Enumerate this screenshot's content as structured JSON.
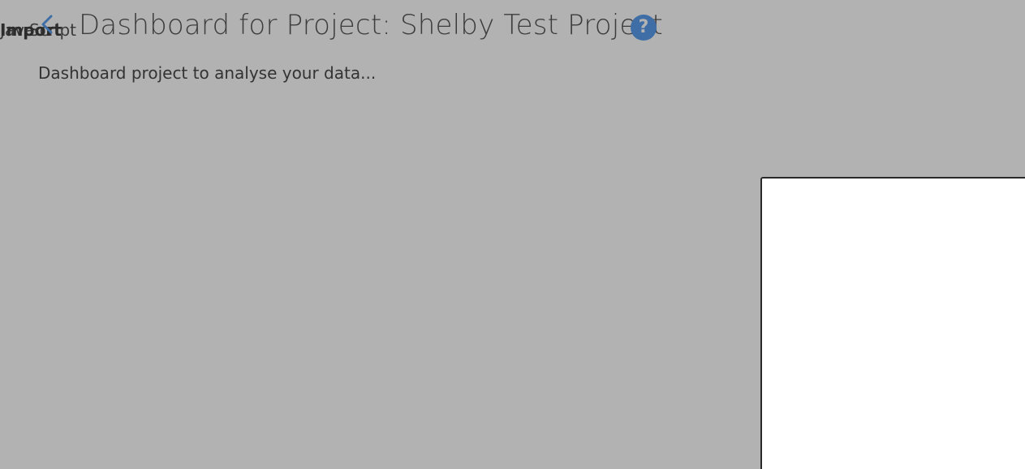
{
  "background_color": "#b2b2b2",
  "accent_color": "#3f6ea6",
  "header": {
    "overlapping_labels": [
      "Java",
      "Script",
      "Vega",
      "Leaflet",
      "Typescript"
    ],
    "overlap_bold_label": "Import",
    "back_icon": "chevron-left-icon",
    "title": "Dashboard for Project: Shelby Test Project",
    "help_icon": "question-circle-icon",
    "help_glyph": "?"
  },
  "description": "Dashboard project to analyse your data...",
  "panel": {
    "background": "#ffffff"
  }
}
